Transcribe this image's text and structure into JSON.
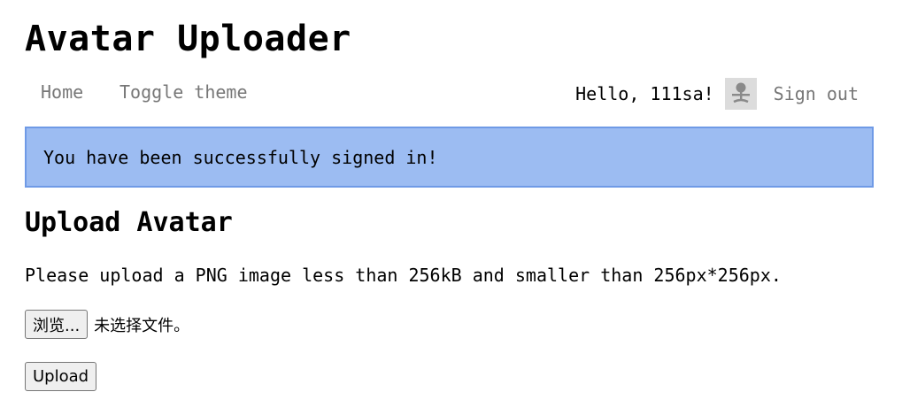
{
  "header": {
    "title": "Avatar Uploader"
  },
  "nav": {
    "home_label": "Home",
    "toggle_theme_label": "Toggle theme",
    "greeting": "Hello, 111sa!",
    "avatar_icon": "user-avatar-icon",
    "signout_label": "Sign out"
  },
  "flash": {
    "message": "You have been successfully signed in!",
    "background_color": "#9cbcf2",
    "border_color": "#6f9ae6"
  },
  "main": {
    "heading": "Upload Avatar",
    "instructions": "Please upload a PNG image less than 256kB and smaller than 256px*256px.",
    "browse_label": "浏览...",
    "file_status": "未选择文件。",
    "upload_label": "Upload"
  },
  "colors": {
    "nav_link": "#777777",
    "text": "#000000"
  }
}
